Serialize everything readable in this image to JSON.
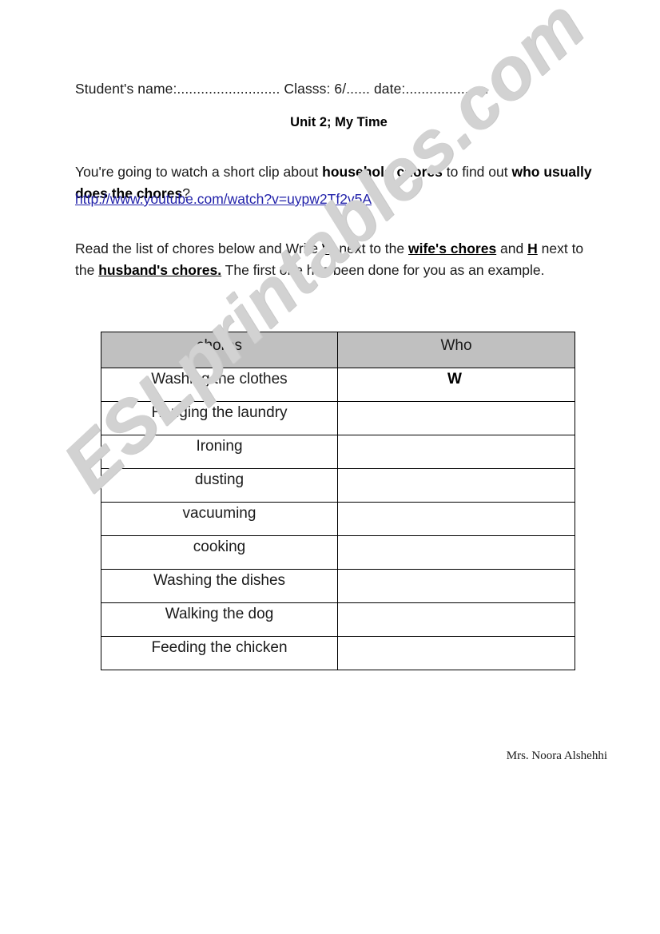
{
  "document": {
    "header_line": "Student's name:.......................... Classs: 6/...... date:.....................",
    "unit_title": "Unit 2; My Time",
    "intro": {
      "part1": "You're going to watch a short clip about ",
      "bold1": "household chores",
      "part2": " to find out ",
      "bold2": "who usually does the chores",
      "part3": "?"
    },
    "video_link": "http://www.youtube.com/watch?v=uypw2Tf2v5A",
    "task": {
      "part1": "Read the list of chores below and Write ",
      "bold_underline1": "W",
      "part2": " next to the ",
      "bold_underline2": "wife's chores",
      "part3": " and ",
      "bold_underline3": "H",
      "part4": " next to the ",
      "bold_underline4": "husband's chores.",
      "part5": " The first one has been done for you as an example."
    },
    "author": "Mrs. Noora Alshehhi",
    "watermark": "ESLprintables.com"
  },
  "table": {
    "columns": [
      "chores",
      "Who"
    ],
    "rows": [
      {
        "chore": "Washing the clothes",
        "who": "W"
      },
      {
        "chore": "Hanging the laundry",
        "who": ""
      },
      {
        "chore": "Ironing",
        "who": ""
      },
      {
        "chore": "dusting",
        "who": ""
      },
      {
        "chore": "vacuuming",
        "who": ""
      },
      {
        "chore": "cooking",
        "who": ""
      },
      {
        "chore": "Washing the dishes",
        "who": ""
      },
      {
        "chore": "Walking the dog",
        "who": ""
      },
      {
        "chore": "Feeding the chicken",
        "who": ""
      }
    ]
  },
  "colors": {
    "header_fill": "#c0c0c0",
    "link": "#2222aa",
    "watermark": "#d2d2d2",
    "border": "#000000"
  }
}
